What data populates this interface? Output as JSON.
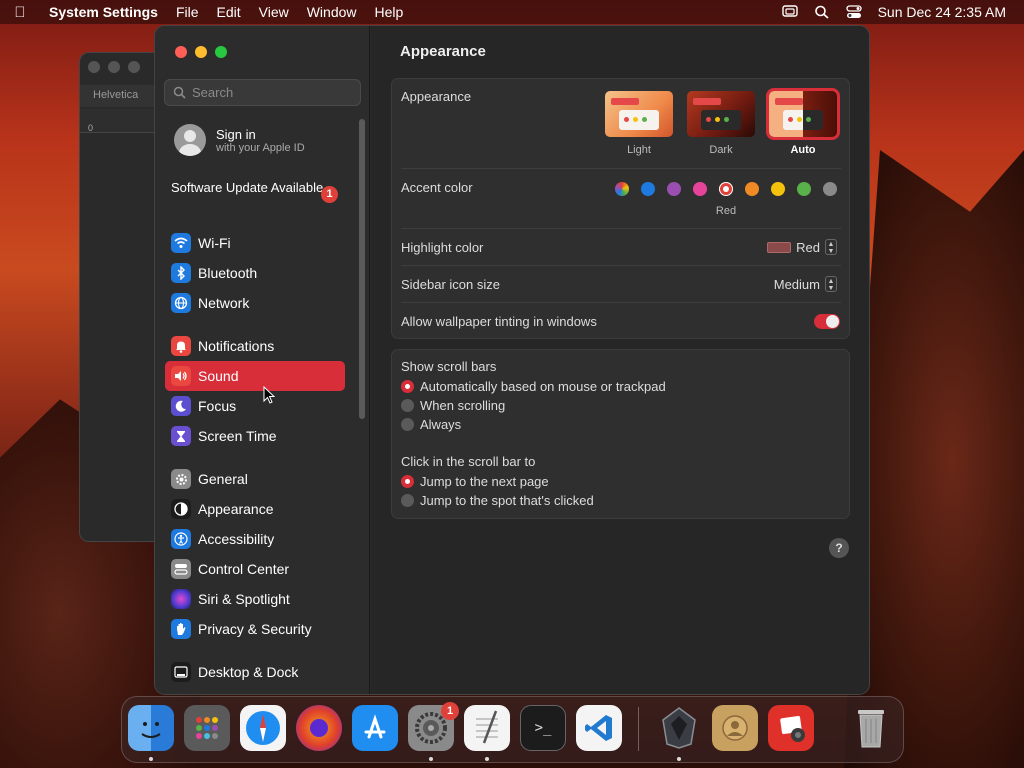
{
  "menubar": {
    "app_name": "System Settings",
    "menus": [
      "File",
      "Edit",
      "View",
      "Window",
      "Help"
    ],
    "clock": "Sun Dec 24  2:35 AM"
  },
  "background_window": {
    "tab_label": "Helvetica",
    "ruler_label": "0"
  },
  "sidebar": {
    "search_placeholder": "Search",
    "signin": {
      "title": "Sign in",
      "subtitle": "with your Apple ID"
    },
    "update": {
      "label": "Software Update Available",
      "badge": "1"
    },
    "items": [
      {
        "label": "Wi-Fi",
        "icon": "wifi-icon",
        "color": "#1f7ae0"
      },
      {
        "label": "Bluetooth",
        "icon": "bluetooth-icon",
        "color": "#1f7ae0"
      },
      {
        "label": "Network",
        "icon": "globe-icon",
        "color": "#1f7ae0"
      },
      {
        "label": "Notifications",
        "icon": "bell-icon",
        "color": "#e9473f"
      },
      {
        "label": "Sound",
        "icon": "speaker-icon",
        "color": "#e9473f",
        "selected": true
      },
      {
        "label": "Focus",
        "icon": "moon-icon",
        "color": "#5b4fd0"
      },
      {
        "label": "Screen Time",
        "icon": "hourglass-icon",
        "color": "#6a4fd0"
      },
      {
        "label": "General",
        "icon": "gear-icon",
        "color": "#8a8a8a"
      },
      {
        "label": "Appearance",
        "icon": "appearance-icon",
        "color": "#1c1c1c"
      },
      {
        "label": "Accessibility",
        "icon": "accessibility-icon",
        "color": "#1f7ae0"
      },
      {
        "label": "Control Center",
        "icon": "control-center-icon",
        "color": "#8a8a8a"
      },
      {
        "label": "Siri & Spotlight",
        "icon": "siri-icon",
        "color": "#8a3ad0"
      },
      {
        "label": "Privacy & Security",
        "icon": "hand-icon",
        "color": "#1f7ae0"
      },
      {
        "label": "Desktop & Dock",
        "icon": "dock-icon",
        "color": "#1c1c1c"
      }
    ]
  },
  "content": {
    "title": "Appearance",
    "appearance": {
      "label": "Appearance",
      "options": [
        {
          "label": "Light"
        },
        {
          "label": "Dark"
        },
        {
          "label": "Auto",
          "selected": true
        }
      ]
    },
    "accent": {
      "label": "Accent color",
      "colors": [
        "multicolor",
        "#1f7ae0",
        "#9a4fb0",
        "#e6449a",
        "#e0403a",
        "#f08a24",
        "#f4c20d",
        "#5ab04a",
        "#8a8a8a"
      ],
      "selected_name": "Red"
    },
    "highlight": {
      "label": "Highlight color",
      "value": "Red"
    },
    "sidebar_icon_size": {
      "label": "Sidebar icon size",
      "value": "Medium"
    },
    "wallpaper_tinting": {
      "label": "Allow wallpaper tinting in windows",
      "enabled": true
    },
    "scroll_bars": {
      "label": "Show scroll bars",
      "options": [
        {
          "label": "Automatically based on mouse or trackpad",
          "selected": true
        },
        {
          "label": "When scrolling",
          "selected": false
        },
        {
          "label": "Always",
          "selected": false
        }
      ]
    },
    "click_scroll": {
      "label": "Click in the scroll bar to",
      "options": [
        {
          "label": "Jump to the next page",
          "selected": true
        },
        {
          "label": "Jump to the spot that's clicked",
          "selected": false
        }
      ]
    },
    "help": "?"
  },
  "dock": {
    "apps": [
      "finder-icon",
      "launchpad-icon",
      "safari-icon",
      "firefox-icon",
      "app-store-icon",
      "system-settings-icon",
      "textedit-icon",
      "terminal-icon",
      "vscode-icon",
      "app-icon",
      "contacts-icon",
      "photo-booth-icon",
      "trash-icon"
    ],
    "settings_badge": "1"
  }
}
